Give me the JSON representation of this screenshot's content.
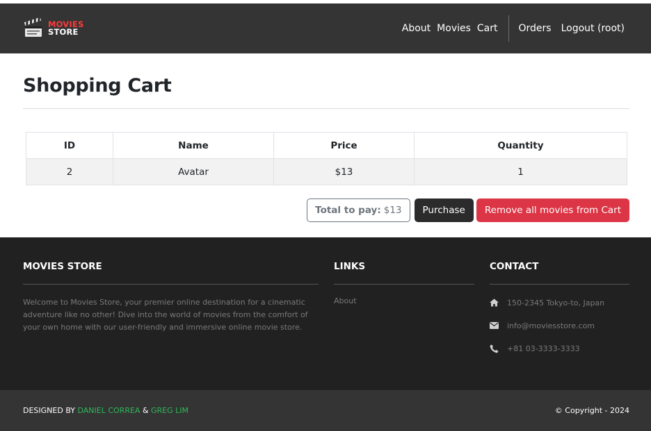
{
  "navbar": {
    "brand_line1": "MOVIES",
    "brand_line2": "STORE",
    "links": [
      "About",
      "Movies",
      "Cart"
    ],
    "user_links": [
      "Orders",
      "Logout (root)"
    ]
  },
  "page": {
    "title": "Shopping Cart"
  },
  "cart_table": {
    "headers": [
      "ID",
      "Name",
      "Price",
      "Quantity"
    ],
    "rows": [
      [
        "2",
        "Avatar",
        "$13",
        "1"
      ]
    ]
  },
  "actions": {
    "total_label": "Total to pay:",
    "total_value": "$13",
    "purchase_label": "Purchase",
    "remove_all_label": "Remove all movies from Cart"
  },
  "footer": {
    "about_title": "MOVIES STORE",
    "about_text": "Welcome to Movies Store, your premier online destination for a cinematic adventure like no other! Dive into the world of movies from the comfort of your own home with our user-friendly and immersive online movie store.",
    "links_title": "LINKS",
    "links": [
      "About"
    ],
    "contact_title": "CONTACT",
    "contact": {
      "address": "150-2345 Tokyo-to, Japan",
      "email": "info@moviesstore.com",
      "phone": "+81 03-3333-3333"
    },
    "designed_prefix": "DESIGNED BY",
    "designer1": "DANIEL CORREA",
    "amp": "&",
    "designer2": "GREG LIM",
    "copyright": "© Copyright - 2024"
  },
  "colors": {
    "navbar_bg": "#343434",
    "footer_bg": "#212121",
    "brand_red": "#ff3b3b",
    "danger": "#dc3545",
    "designer_green": "#2fb75a"
  }
}
